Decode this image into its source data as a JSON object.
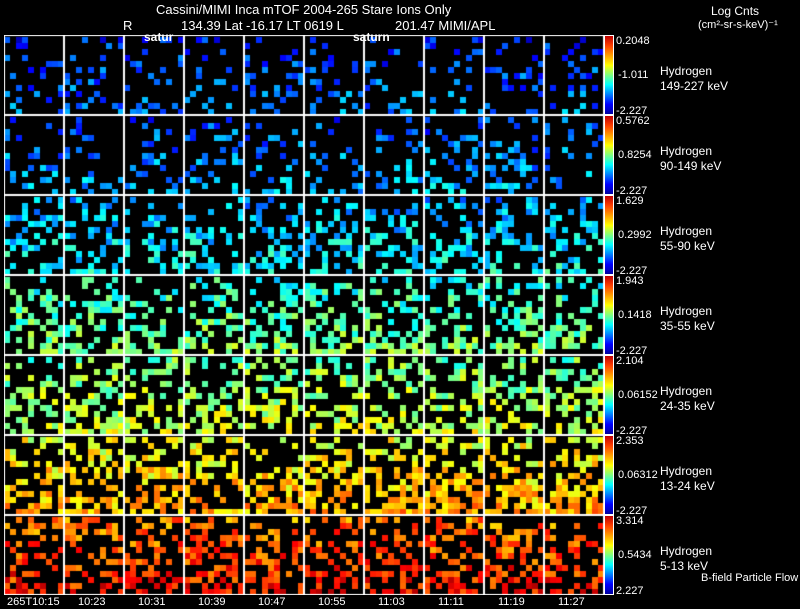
{
  "header": {
    "title": "Cassini/MIMI Inca mTOF  2004-265   Stare   Ions Only",
    "r_label": "R",
    "r_line": "134.39 Lat -16.17 LT 0619 L",
    "l_value": "201.47  MIMI/APL",
    "satur_label": "satur",
    "saturn_label": "saturn"
  },
  "units": {
    "line1": "Log Cnts",
    "line2": "(cm²-sr-s-keV)⁻¹"
  },
  "footer_label": "B-field Particle Flow",
  "chart_data": {
    "type": "heatmap",
    "title": "Cassini/MIMI Inca mTOF 2004-265 Stare Ions Only",
    "x_tick_labels": [
      "265T10:15",
      "10:23",
      "10:31",
      "10:39",
      "10:47",
      "10:55",
      "11:03",
      "11:11",
      "11:19",
      "11:27"
    ],
    "rows": [
      {
        "species": "Hydrogen",
        "energy": "149-227 keV",
        "max": "0.2048",
        "mid": "-1.011",
        "min": "-2.227",
        "level": 0.15,
        "density": 0.25
      },
      {
        "species": "Hydrogen",
        "energy": "90-149 keV",
        "max": "0.5762",
        "mid": "0.8254",
        "min": "-2.227",
        "level": 0.2,
        "density": 0.3
      },
      {
        "species": "Hydrogen",
        "energy": "55-90 keV",
        "max": "1.629",
        "mid": "0.2992",
        "min": "-2.227",
        "level": 0.28,
        "density": 0.45
      },
      {
        "species": "Hydrogen",
        "energy": "35-55 keV",
        "max": "1.943",
        "mid": "0.1418",
        "min": "-2.227",
        "level": 0.4,
        "density": 0.5
      },
      {
        "species": "Hydrogen",
        "energy": "24-35 keV",
        "max": "2.104",
        "mid": "0.06152",
        "min": "-2.227",
        "level": 0.48,
        "density": 0.55
      },
      {
        "species": "Hydrogen",
        "energy": "13-24 keV",
        "max": "2.353",
        "mid": "0.06312",
        "min": "-2.227",
        "level": 0.6,
        "density": 0.6
      },
      {
        "species": "Hydrogen",
        "energy": "5-13 keV",
        "max": "3.314",
        "mid": "0.5434",
        "min": "2.227",
        "level": 0.75,
        "density": 0.5
      }
    ]
  }
}
